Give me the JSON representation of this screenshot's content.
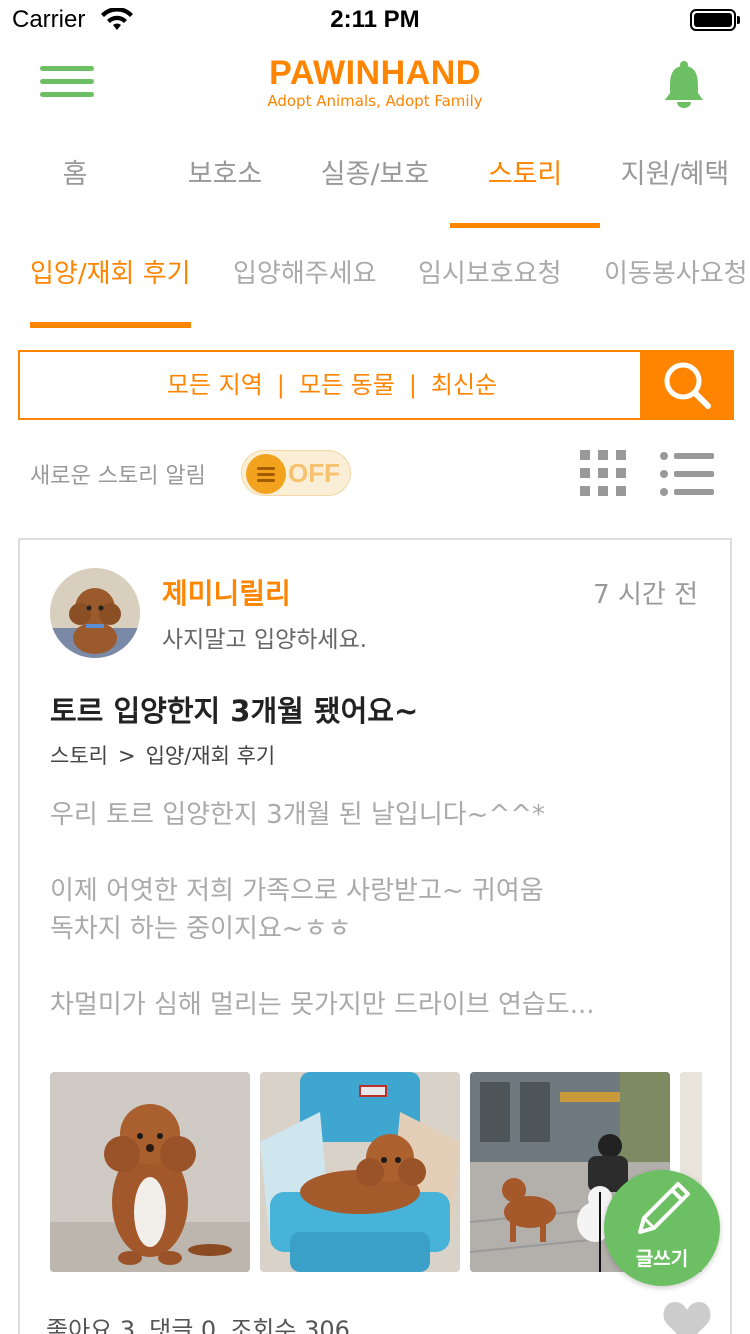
{
  "status_bar": {
    "carrier": "Carrier",
    "time": "2:11 PM"
  },
  "header": {
    "logo_title": "PAWINHAND",
    "logo_subtitle": "Adopt Animals, Adopt Family",
    "menu_icon": "hamburger-menu-icon",
    "bell_icon": "bell-icon"
  },
  "main_tabs": [
    {
      "label": "홈"
    },
    {
      "label": "보호소"
    },
    {
      "label": "실종/보호"
    },
    {
      "label": "스토리",
      "active": true
    },
    {
      "label": "지원/혜택"
    }
  ],
  "sub_tabs": [
    {
      "label": "입양/재회 후기",
      "active": true
    },
    {
      "label": "입양해주세요"
    },
    {
      "label": "임시보호요청"
    },
    {
      "label": "이동봉사요청"
    }
  ],
  "search": {
    "region": "모든 지역",
    "separator": "|",
    "animal": "모든 동물",
    "sort": "최신순",
    "icon": "search-icon"
  },
  "alarm": {
    "label": "새로운 스토리 알림",
    "toggle_state": "OFF",
    "grid_icon": "grid-view-icon",
    "list_icon": "list-view-icon"
  },
  "post": {
    "author": "제미니릴리",
    "author_bio": "사지말고 입양하세요.",
    "time_ago": "7 시간 전",
    "title": "토르 입양한지 3개월 됐어요~",
    "breadcrumb": {
      "category": "스토리",
      "arrow": ">",
      "subcategory": "입양/재회 후기"
    },
    "body_lines": [
      "우리 토르 입양한지 3개월 된 날입니다~^^*",
      "",
      "이제 어엿한 저희 가족으로 사랑받고~ 귀여움",
      "독차지 하는 중이지요~ㅎㅎ",
      "",
      "차멀미가 심해 멀리는 못가지만 드라이브 연습도..."
    ],
    "stats": {
      "likes": "좋아요 3",
      "comments": "댓글 0",
      "views": "조회수 306"
    },
    "like_icon": "heart-icon"
  },
  "fab": {
    "label": "글쓰기",
    "icon": "pencil-icon"
  },
  "colors": {
    "brand_orange": "#ff8400",
    "brand_green": "#6cc063",
    "muted_text": "#999999"
  }
}
